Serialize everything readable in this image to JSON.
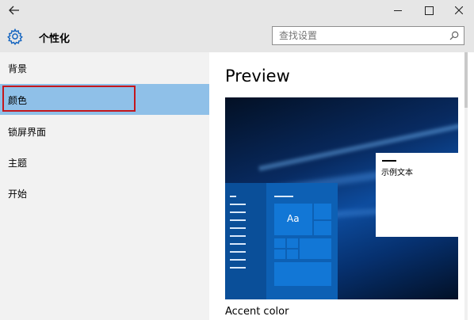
{
  "titlebar": {
    "back_icon": "back-arrow-icon",
    "minimize_icon": "minimize-icon",
    "maximize_icon": "maximize-icon",
    "close_icon": "close-icon"
  },
  "header": {
    "icon": "gear-icon",
    "title": "个性化",
    "search": {
      "placeholder": "查找设置",
      "icon": "search-icon"
    }
  },
  "sidebar": {
    "items": [
      {
        "label": "背景"
      },
      {
        "label": "颜色",
        "selected": true
      },
      {
        "label": "锁屏界面"
      },
      {
        "label": "主题"
      },
      {
        "label": "开始"
      }
    ],
    "highlight_color": "#c4161c",
    "selected_color": "#8fc0e8"
  },
  "main": {
    "preview_title": "Preview",
    "tile_text": "Aa",
    "sample_text": "示例文本",
    "accent_label": "Accent color"
  },
  "colors": {
    "accent": "#0d60b4",
    "chrome": "#e6e6e6",
    "sidebar": "#f2f2f2"
  }
}
